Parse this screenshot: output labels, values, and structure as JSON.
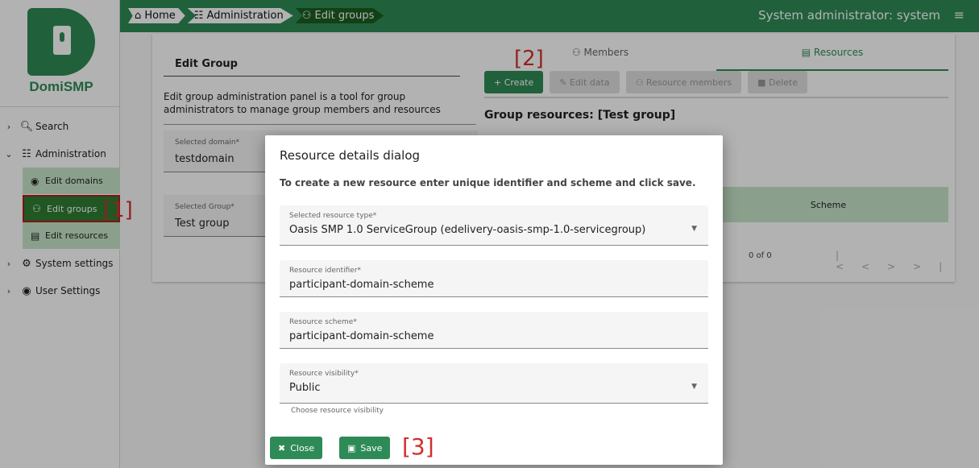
{
  "app": {
    "logo_text": "DomiSMP",
    "user_title": "System administrator: system",
    "breadcrumb": [
      "Home",
      "Administration",
      "Edit groups"
    ]
  },
  "sidebar": {
    "items": [
      {
        "label": "Search",
        "icon": "search-icon"
      },
      {
        "label": "Administration",
        "icon": "sliders-icon"
      },
      {
        "label": "Edit domains",
        "icon": "account-circle-icon"
      },
      {
        "label": "Edit groups",
        "icon": "group-icon"
      },
      {
        "label": "Edit resources",
        "icon": "list-icon"
      },
      {
        "label": "System settings",
        "icon": "settings-icon"
      },
      {
        "label": "User Settings",
        "icon": "user-icon"
      }
    ]
  },
  "edit_group": {
    "title": "Edit Group",
    "description": "Edit group administration panel is a tool for group administrators to manage group members and resources",
    "domain_label": "Selected domain*",
    "domain_value": "testdomain",
    "group_label": "Selected Group*",
    "group_value": "Test group"
  },
  "tabs": {
    "members": "Members",
    "resources": "Resources"
  },
  "toolbar": {
    "create": "+ Create",
    "edit_data": "Edit data",
    "resource_members": "Resource members",
    "delete": "Delete"
  },
  "resources": {
    "title": "Group resources: [Test group]",
    "scheme_header": "Scheme",
    "paginator": "0 of 0"
  },
  "markers": [
    "[1]",
    "[2]",
    "[3]"
  ],
  "dialog": {
    "title": "Resource details dialog",
    "description": "To create a new resource enter unique identifier and scheme and click save.",
    "resource_type_label": "Selected resource type*",
    "resource_type_value": "Oasis SMP 1.0 ServiceGroup (edelivery-oasis-smp-1.0-servicegroup)",
    "identifier_label": "Resource identifier*",
    "identifier_value": "participant-domain-scheme",
    "scheme_label": "Resource scheme*",
    "scheme_value": "participant-domain-scheme",
    "visibility_label": "Resource visibility*",
    "visibility_value": "Public",
    "visibility_hint": "Choose resource visibility",
    "close_label": "Close",
    "save_label": "Save"
  },
  "colors": {
    "primary": "#2e8b57",
    "marker": "#d32f2f"
  }
}
